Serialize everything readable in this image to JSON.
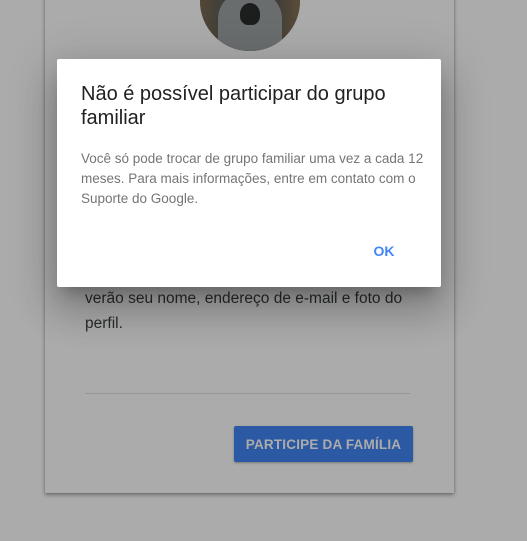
{
  "background_page": {
    "description_text": "verão seu nome, endereço de e-mail e foto do perfil.",
    "join_button_label": "PARTICIPE DA FAMÍLIA"
  },
  "dialog": {
    "title": "Não é possível participar do grupo familiar",
    "body": "Você só pode trocar de grupo familiar uma vez a cada 12 meses. Para mais informações, entre em contato com o Suporte do Google.",
    "ok_label": "OK"
  },
  "colors": {
    "accent": "#4285f4",
    "scrim": "rgba(0,0,0,0.33)",
    "title_text": "#212121",
    "body_text": "#757575"
  }
}
